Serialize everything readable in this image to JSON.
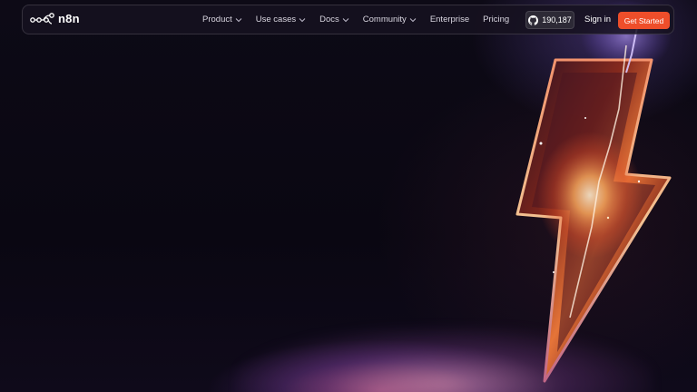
{
  "brand": {
    "name": "n8n",
    "logo_icon": "n8n-nodes-logo-icon"
  },
  "nav": {
    "items": [
      {
        "label": "Product",
        "has_dropdown": true
      },
      {
        "label": "Use cases",
        "has_dropdown": true
      },
      {
        "label": "Docs",
        "has_dropdown": true
      },
      {
        "label": "Community",
        "has_dropdown": true
      },
      {
        "label": "Enterprise",
        "has_dropdown": false
      },
      {
        "label": "Pricing",
        "has_dropdown": false
      }
    ]
  },
  "actions": {
    "github_stars": "190,187",
    "github_icon": "github-icon",
    "signin_label": "Sign in",
    "cta_label": "Get Started"
  },
  "colors": {
    "background": "#0c0814",
    "accent": "#ee4e2a",
    "nav_text": "#d9d6e0"
  },
  "hero": {
    "graphic": "lightning-bolt-illustration"
  }
}
